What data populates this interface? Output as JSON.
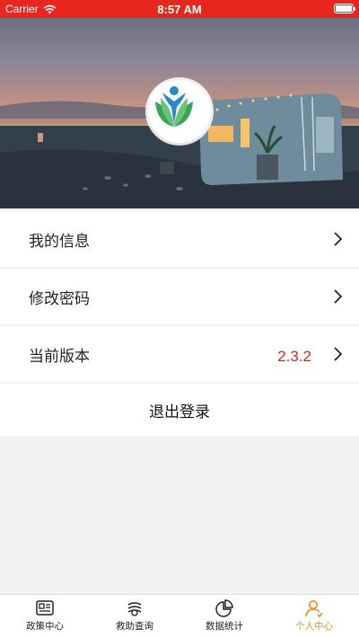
{
  "status_bar": {
    "carrier": "Carrier",
    "time": "8:57 AM"
  },
  "menu": [
    {
      "label": "我的信息"
    },
    {
      "label": "修改密码"
    },
    {
      "label": "当前版本",
      "value": "2.3.2"
    }
  ],
  "logout_label": "退出登录",
  "tabs": [
    {
      "label": "政策中心",
      "icon": "news-icon",
      "active": false
    },
    {
      "label": "救助查询",
      "icon": "search-help-icon",
      "active": false
    },
    {
      "label": "数据统计",
      "icon": "pie-chart-icon",
      "active": false
    },
    {
      "label": "个人中心",
      "icon": "person-icon",
      "active": true
    }
  ],
  "colors": {
    "accent": "#e8261e",
    "active_tab": "#f08a24",
    "version": "#e3211c"
  }
}
